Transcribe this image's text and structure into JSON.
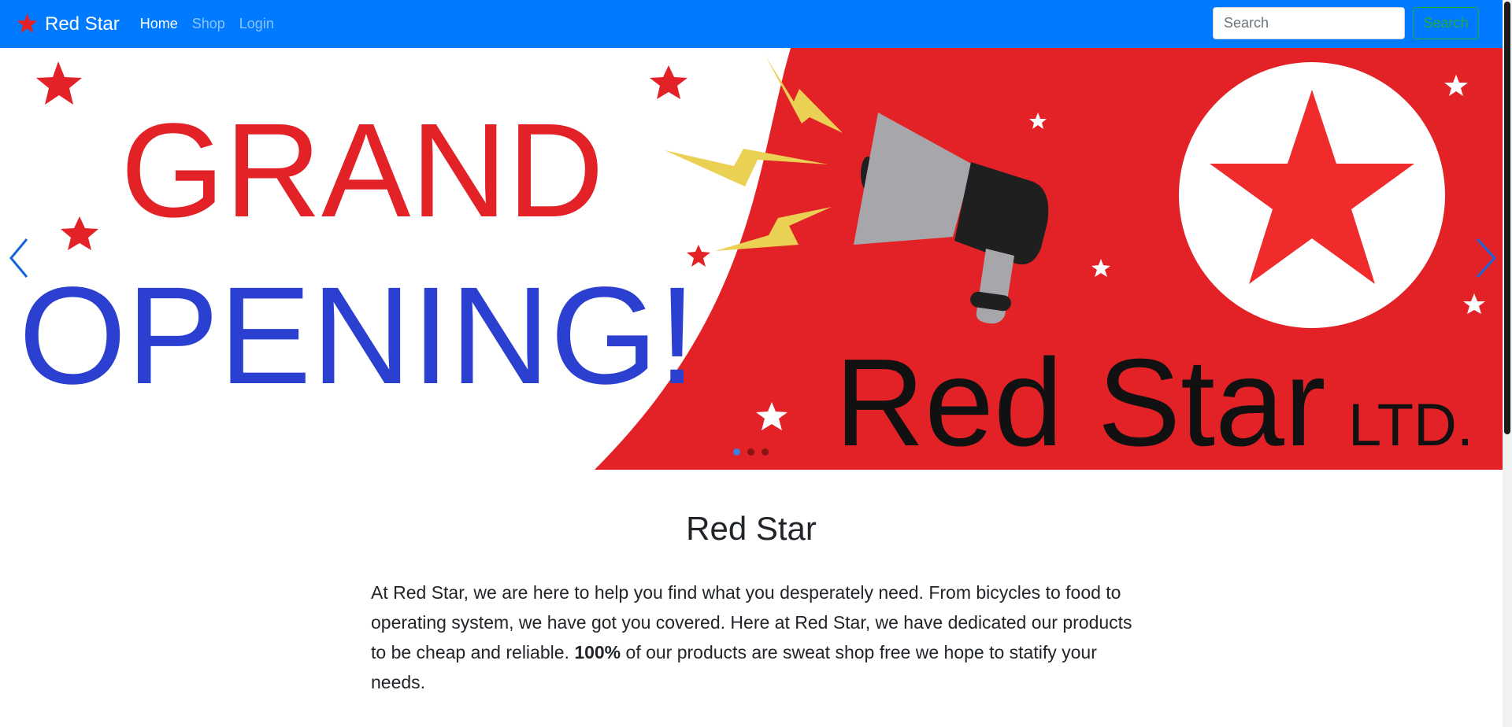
{
  "navbar": {
    "brand": "Red Star",
    "links": [
      {
        "label": "Home",
        "active": true
      },
      {
        "label": "Shop",
        "active": false
      },
      {
        "label": "Login",
        "active": false
      }
    ],
    "search": {
      "placeholder": "Search",
      "value": "",
      "button_label": "Search"
    },
    "colors": {
      "background": "#007bff",
      "search_button": "#28a745"
    }
  },
  "carousel": {
    "slide": {
      "headline_line1": "GRAND",
      "headline_line2": "OPENING!",
      "company_name": "Red Star",
      "company_suffix": "LTD."
    },
    "slide_count": 3,
    "active_slide": 1,
    "colors": {
      "red": "#e32227",
      "blue": "#2b3fd1",
      "yellow": "#ead153",
      "megaphone_grey": "#a7a7ab",
      "megaphone_dark": "#1f1f1f"
    }
  },
  "main": {
    "heading": "Red Star",
    "intro_part1": "At Red Star, we are here to help you find what you desperately need. From bicycles to food to operating system, we have got you covered. Here at Red Star, we have dedicated our products to be cheap and reliable. ",
    "intro_bold": "100%",
    "intro_part2": " of our products are sweat shop free we hope to statify your needs."
  }
}
